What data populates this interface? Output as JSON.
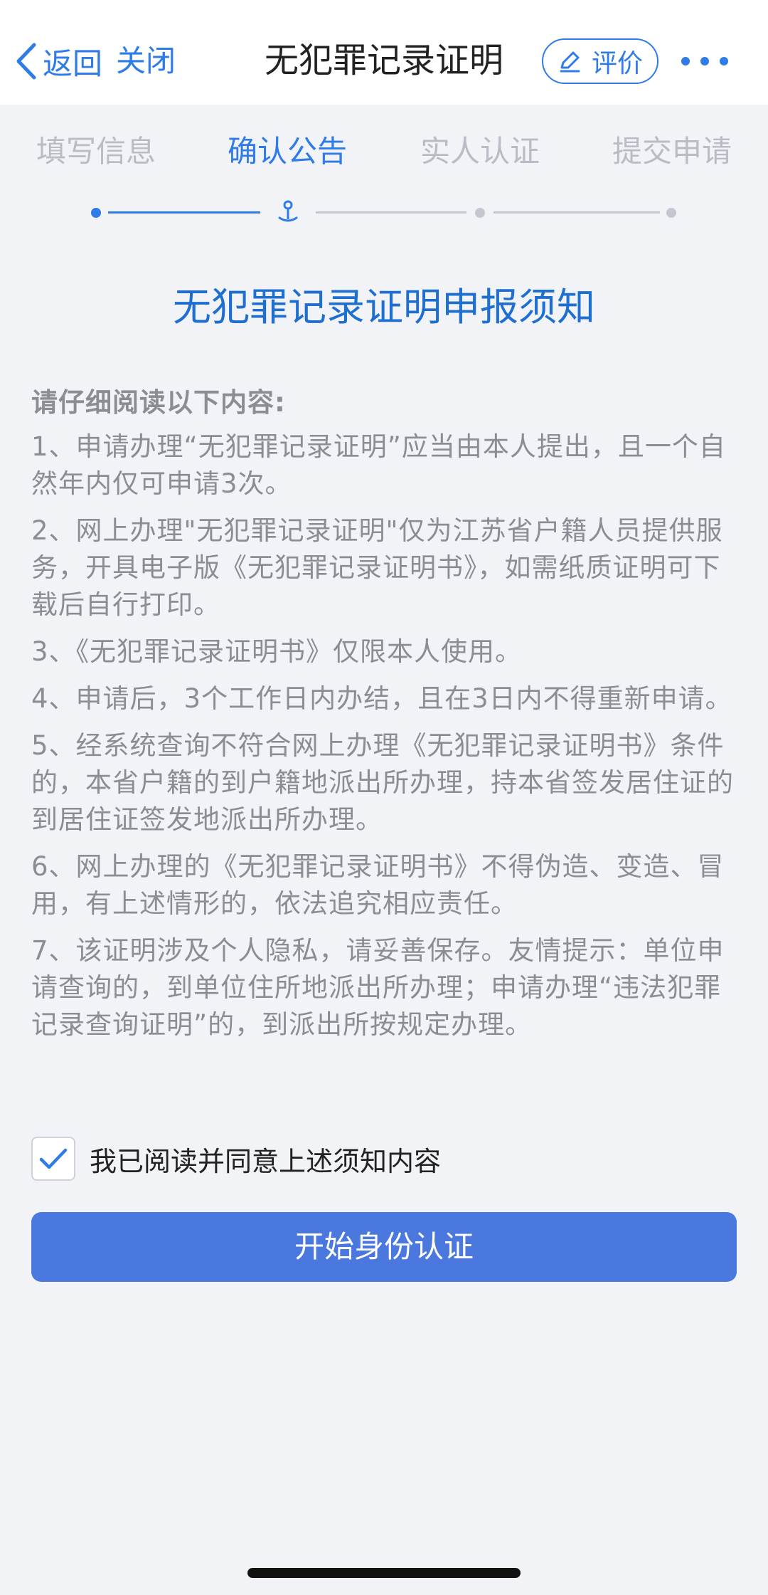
{
  "navbar": {
    "back_label": "返回",
    "close_label": "关闭",
    "title": "无犯罪记录证明",
    "rate_label": "评价",
    "accent_color": "#2f7be8"
  },
  "steps": [
    {
      "label": "填写信息",
      "state": "done"
    },
    {
      "label": "确认公告",
      "state": "current"
    },
    {
      "label": "实人认证",
      "state": "pending"
    },
    {
      "label": "提交申请",
      "state": "pending"
    }
  ],
  "notice": {
    "title": "无犯罪记录证明申报须知",
    "lead": "请仔细阅读以下内容:",
    "items": [
      "1、申请办理“无犯罪记录证明”应当由本人提出，且一个自然年内仅可申请3次。",
      "2、网上办理\"无犯罪记录证明\"仅为江苏省户籍人员提供服务，开具电子版《无犯罪记录证明书》，如需纸质证明可下载后自行打印。",
      "3、《无犯罪记录证明书》仅限本人使用。",
      "4、申请后，3个工作日内办结，且在3日内不得重新申请。",
      "5、经系统查询不符合网上办理《无犯罪记录证明书》条件的，本省户籍的到户籍地派出所办理，持本省签发居住证的到居住证签发地派出所办理。",
      "6、网上办理的《无犯罪记录证明书》不得伪造、变造、冒用，有上述情形的，依法追究相应责任。",
      "7、该证明涉及个人隐私，请妥善保存。友情提示：单位申请查询的，到单位住所地派出所办理；申请办理“违法犯罪记录查询证明”的，到派出所按规定办理。"
    ]
  },
  "agreement": {
    "label": "我已阅读并同意上述须知内容",
    "checked": true
  },
  "primary_button": {
    "label": "开始身份认证",
    "color": "#4a78df"
  }
}
